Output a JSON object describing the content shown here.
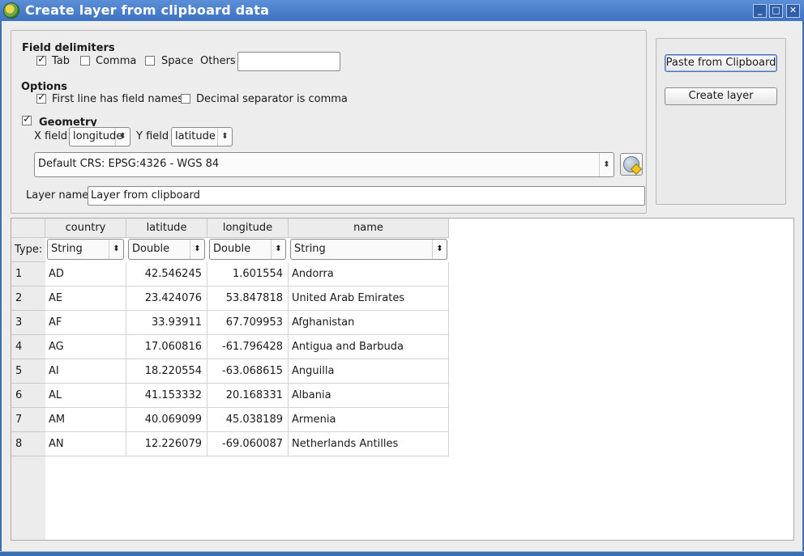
{
  "window": {
    "title": "Create layer from clipboard data",
    "buttons": {
      "minimize": "_",
      "maximize": "□",
      "close": "✕"
    }
  },
  "field_delimiters": {
    "heading": "Field delimiters",
    "tab": {
      "label": "Tab",
      "checked": true
    },
    "comma": {
      "label": "Comma",
      "checked": false
    },
    "space": {
      "label": "Space",
      "checked": false
    },
    "others": {
      "label": "Others",
      "value": ""
    }
  },
  "options": {
    "heading": "Options",
    "first_line": {
      "label": "First line has field names",
      "checked": true
    },
    "decimal_comma": {
      "label": "Decimal separator is comma",
      "checked": false
    }
  },
  "geometry": {
    "label": "Geometry",
    "checked": true,
    "x_field_label": "X field",
    "x_field_value": "longitude",
    "y_field_label": "Y field",
    "y_field_value": "latitude",
    "crs_value": "Default CRS: EPSG:4326 - WGS 84"
  },
  "layer": {
    "label": "Layer name",
    "value": "Layer from clipboard"
  },
  "actions": {
    "paste": "Paste from Clipboard",
    "create": "Create layer"
  },
  "table": {
    "type_label": "Type:",
    "columns": [
      {
        "name": "country",
        "type": "String"
      },
      {
        "name": "latitude",
        "type": "Double"
      },
      {
        "name": "longitude",
        "type": "Double"
      },
      {
        "name": "name",
        "type": "String"
      }
    ],
    "rows": [
      {
        "n": "1",
        "country": "AD",
        "latitude": "42.546245",
        "longitude": "1.601554",
        "name": "Andorra"
      },
      {
        "n": "2",
        "country": "AE",
        "latitude": "23.424076",
        "longitude": "53.847818",
        "name": "United Arab Emirates"
      },
      {
        "n": "3",
        "country": "AF",
        "latitude": "33.93911",
        "longitude": "67.709953",
        "name": "Afghanistan"
      },
      {
        "n": "4",
        "country": "AG",
        "latitude": "17.060816",
        "longitude": "-61.796428",
        "name": "Antigua and Barbuda"
      },
      {
        "n": "5",
        "country": "AI",
        "latitude": "18.220554",
        "longitude": "-63.068615",
        "name": "Anguilla"
      },
      {
        "n": "6",
        "country": "AL",
        "latitude": "41.153332",
        "longitude": "20.168331",
        "name": "Albania"
      },
      {
        "n": "7",
        "country": "AM",
        "latitude": "40.069099",
        "longitude": "45.038189",
        "name": "Armenia"
      },
      {
        "n": "8",
        "country": "AN",
        "latitude": "12.226079",
        "longitude": "-69.060087",
        "name": "Netherlands Antilles"
      }
    ]
  }
}
